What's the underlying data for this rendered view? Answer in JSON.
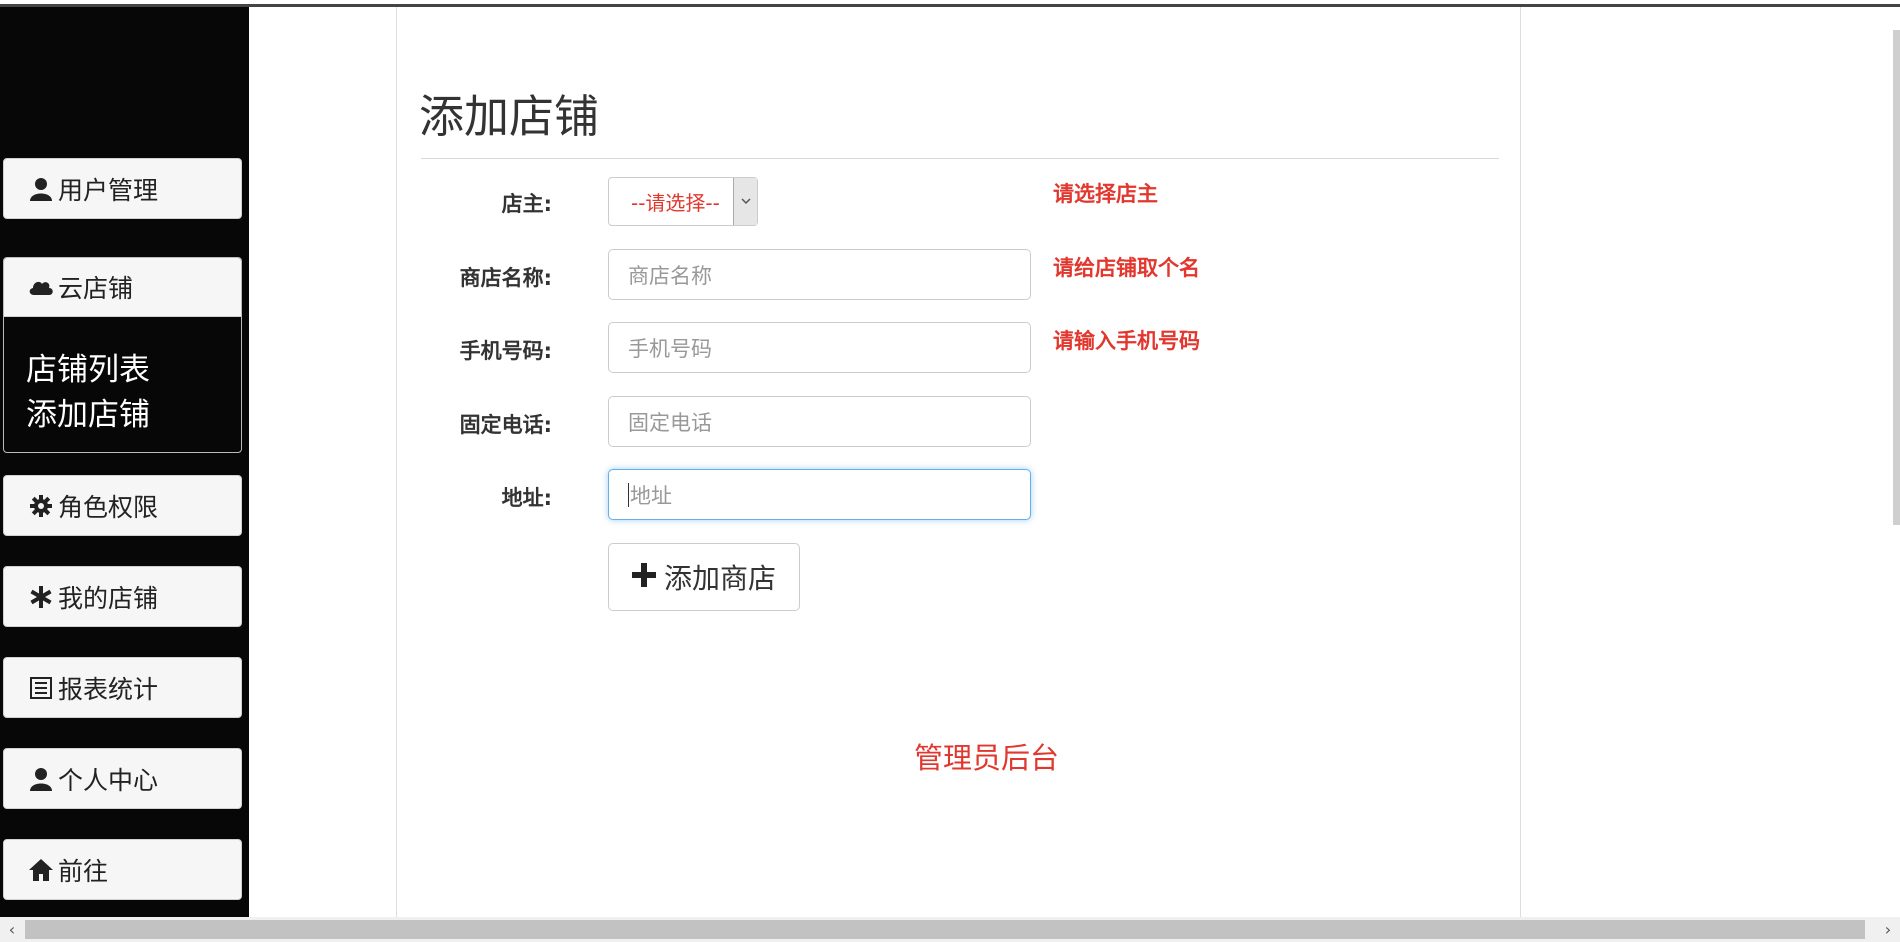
{
  "sidebar": {
    "items": [
      {
        "label": "用户管理",
        "icon": "user-icon"
      },
      {
        "label": "云店铺",
        "icon": "cloud-icon"
      },
      {
        "label": "角色权限",
        "icon": "gear-icon"
      },
      {
        "label": "我的店铺",
        "icon": "asterisk-icon"
      },
      {
        "label": "报表统计",
        "icon": "list-icon"
      },
      {
        "label": "个人中心",
        "icon": "user-icon"
      },
      {
        "label": "前往",
        "icon": "home-icon"
      }
    ],
    "submenu": [
      "店铺列表",
      "添加店铺"
    ]
  },
  "page": {
    "title": "添加店铺",
    "footer": "管理员后台"
  },
  "form": {
    "owner_label": "店主:",
    "owner_value": "--请选择--",
    "owner_error": "请选择店主",
    "name_label": "商店名称:",
    "name_placeholder": "商店名称",
    "name_error": "请给店铺取个名",
    "phone_label": "手机号码:",
    "phone_placeholder": "手机号码",
    "phone_error": "请输入手机号码",
    "tel_label": "固定电话:",
    "tel_placeholder": "固定电话",
    "address_label": "地址:",
    "address_placeholder": "地址",
    "submit_label": "添加商店"
  },
  "colors": {
    "error": "#e2372e",
    "sidebar_bg": "#070707",
    "focus": "#66afe9"
  }
}
